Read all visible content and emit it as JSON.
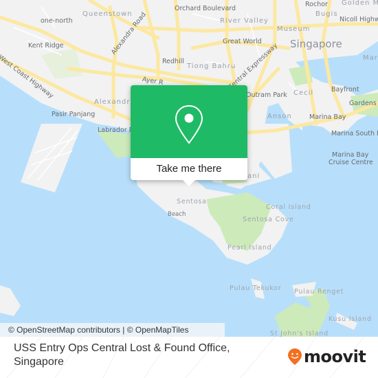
{
  "map": {
    "labels": {
      "queenstown": "Queenstown",
      "orchard_boulevard": "Orchard Boulevard",
      "rochor": "Rochor",
      "golden_mile": "Golden Mi",
      "one_north": "one-north",
      "river_valley": "River Valley",
      "bugis": "Bugis",
      "nicoll_highway": "Nicoll Highwa",
      "museum": "Museum",
      "kent_ridge": "Kent Ridge",
      "alexandra_road": "Alexandra Road",
      "great_world": "Great World",
      "singapore": "Singapore",
      "west_coast_highway": "West Coast Highway",
      "redhill": "Redhill",
      "tiong_bahru": "Tiong Bahru",
      "central_expressway": "Central Expressway",
      "ayer_rajah": "Ayer R",
      "alexandra": "Alexandra",
      "outram_park": "Outram Park",
      "cecil": "Cecil",
      "bayfront": "Bayfront",
      "gardens": "Gardens b",
      "marina_partial": "Mar",
      "pasir_panjang": "Pasir Panjang",
      "labrador_park": "Labrador Pa",
      "anson": "Anson",
      "marina_bay": "Marina Bay",
      "marina_south_pier": "Marina South Pier",
      "marina_bay_cruise_centre_1": "Marina Bay",
      "marina_bay_cruise_centre_2": "Cruise Centre",
      "keppel_partial": "ani",
      "sentosa": "Sentosa",
      "beach": "Beach",
      "coral_island": "Coral Island",
      "sentosa_cove": "Sentosa Cove",
      "pearl_island": "Pearl Island",
      "pulau_tekukor": "Pulau Tekukor",
      "pulau_renget": "Pulau Renget",
      "kusu_island": "Kusu Island",
      "st_johns_island": "St John's Island"
    },
    "colors": {
      "water": "#b7dffb",
      "land": "#f2f2f2",
      "road": "#fce8a0",
      "park": "#cdeabb"
    }
  },
  "popup": {
    "icon": "map-pin-icon",
    "button_label": "Take me there",
    "color": "#1fba66"
  },
  "attribution": "© OpenStreetMap contributors | © OpenMapTiles",
  "footer": {
    "place_name_line1": "USS Entry Ops Central Lost & Found Office,",
    "place_name_line2": "Singapore",
    "logo_text": "moovit",
    "logo_icon": "moovit-smiley-pin-icon",
    "logo_color": "#f36f21"
  }
}
